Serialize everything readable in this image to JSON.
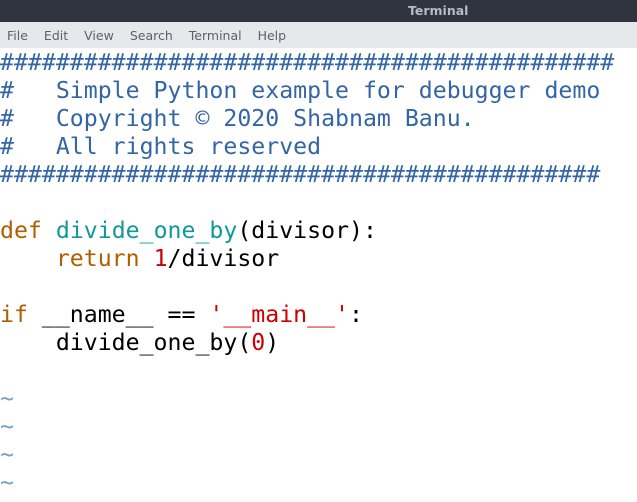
{
  "window": {
    "title": "Terminal"
  },
  "menubar": {
    "items": [
      {
        "label": "File"
      },
      {
        "label": "Edit"
      },
      {
        "label": "View"
      },
      {
        "label": "Search"
      },
      {
        "label": "Terminal"
      },
      {
        "label": "Help"
      }
    ]
  },
  "editor": {
    "colors": {
      "comment": "#3465a4",
      "keyword": "#af5f00",
      "function": "#11999a",
      "literal": "#cc0000",
      "empty_line_marker": "#729fcf"
    },
    "lines": [
      {
        "tokens": [
          {
            "type": "cm",
            "text": "############################################"
          }
        ]
      },
      {
        "tokens": [
          {
            "type": "cm",
            "text": "#   Simple Python example for debugger demo"
          }
        ]
      },
      {
        "tokens": [
          {
            "type": "cm",
            "text": "#   Copyright © 2020 Shabnam Banu."
          }
        ]
      },
      {
        "tokens": [
          {
            "type": "cm",
            "text": "#   All rights reserved"
          }
        ]
      },
      {
        "tokens": [
          {
            "type": "cm",
            "text": "###########################################"
          }
        ]
      },
      {
        "tokens": []
      },
      {
        "tokens": [
          {
            "type": "kw",
            "text": "def"
          },
          {
            "type": "plain",
            "text": " "
          },
          {
            "type": "fn",
            "text": "divide_one_by"
          },
          {
            "type": "plain",
            "text": "(divisor):"
          }
        ]
      },
      {
        "tokens": [
          {
            "type": "plain",
            "text": "    "
          },
          {
            "type": "kw",
            "text": "return"
          },
          {
            "type": "plain",
            "text": " "
          },
          {
            "type": "num",
            "text": "1"
          },
          {
            "type": "plain",
            "text": "/divisor"
          }
        ]
      },
      {
        "tokens": []
      },
      {
        "tokens": [
          {
            "type": "kw",
            "text": "if"
          },
          {
            "type": "plain",
            "text": " __name__ == "
          },
          {
            "type": "str",
            "text": "'__main__'"
          },
          {
            "type": "plain",
            "text": ":"
          }
        ]
      },
      {
        "tokens": [
          {
            "type": "plain",
            "text": "    divide_one_by("
          },
          {
            "type": "num",
            "text": "0"
          },
          {
            "type": "plain",
            "text": ")"
          }
        ]
      },
      {
        "tokens": []
      },
      {
        "tokens": [
          {
            "type": "tilde",
            "text": "~"
          }
        ]
      },
      {
        "tokens": [
          {
            "type": "tilde",
            "text": "~"
          }
        ]
      },
      {
        "tokens": [
          {
            "type": "tilde",
            "text": "~"
          }
        ]
      },
      {
        "tokens": [
          {
            "type": "tilde",
            "text": "~"
          }
        ]
      }
    ]
  }
}
